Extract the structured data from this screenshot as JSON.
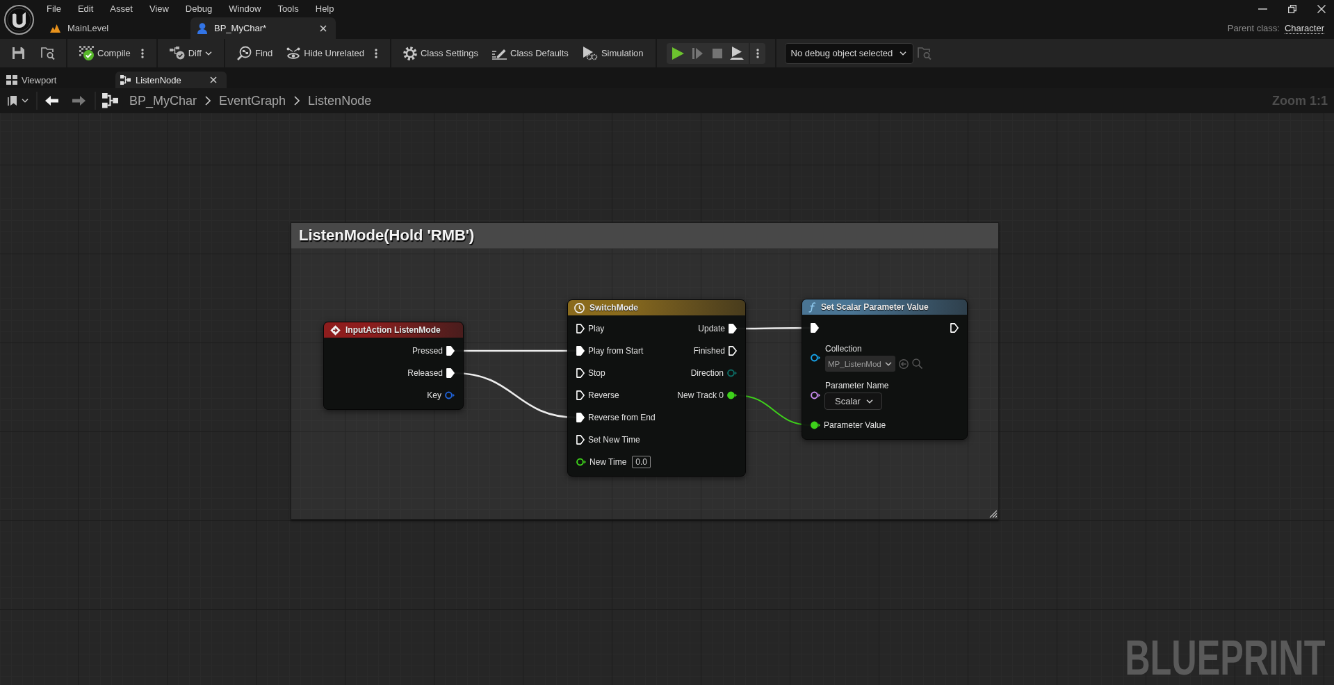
{
  "menu_bar": {
    "items": [
      "File",
      "Edit",
      "Asset",
      "View",
      "Debug",
      "Window",
      "Tools",
      "Help"
    ]
  },
  "document_tabs": [
    {
      "label": "MainLevel",
      "kind": "level",
      "selected": false
    },
    {
      "label": "BP_MyChar*",
      "kind": "blueprint",
      "selected": true
    }
  ],
  "parent_class": {
    "label": "Parent class:",
    "value": "Character"
  },
  "toolbar": {
    "buttons": [
      {
        "kind": "compile",
        "label": "Compile"
      },
      {
        "kind": "diff",
        "label": "Diff"
      },
      {
        "kind": "find",
        "label": "Find"
      },
      {
        "kind": "hide_unrelated",
        "label": "Hide Unrelated"
      },
      {
        "kind": "class_settings",
        "label": "Class Settings"
      },
      {
        "kind": "class_defaults",
        "label": "Class Defaults"
      },
      {
        "kind": "simulation",
        "label": "Simulation"
      }
    ],
    "play_controls": [
      {
        "kind": "play",
        "disabled": false
      },
      {
        "kind": "step",
        "disabled": true
      },
      {
        "kind": "stop",
        "disabled": true
      },
      {
        "kind": "possess",
        "disabled": false
      }
    ],
    "debug_object": "No debug object selected"
  },
  "editor_tabs": [
    {
      "label": "Viewport",
      "kind": "viewport",
      "selected": false
    },
    {
      "label": "ListenNode",
      "kind": "graph",
      "selected": true
    }
  ],
  "breadcrumb": [
    "BP_MyChar",
    "EventGraph",
    "ListenNode"
  ],
  "graph": {
    "zoom": "Zoom 1:1",
    "comment": {
      "title": "ListenMode(Hold 'RMB')"
    },
    "nodes": [
      {
        "kind": "event",
        "title": "InputAction ListenMode",
        "color": "#8e1d1d",
        "outputs": [
          {
            "label": "Pressed",
            "kind": "exec",
            "connected": true
          },
          {
            "label": "Released",
            "kind": "exec",
            "connected": true
          },
          {
            "label": "Key",
            "kind": "struct",
            "connected": false
          }
        ]
      },
      {
        "kind": "timeline",
        "title": "SwitchMode",
        "color": "#8a6b1d",
        "inputs": [
          {
            "label": "Play",
            "kind": "exec",
            "connected": false
          },
          {
            "label": "Play from Start",
            "kind": "exec",
            "connected": true
          },
          {
            "label": "Stop",
            "kind": "exec",
            "connected": false
          },
          {
            "label": "Reverse",
            "kind": "exec",
            "connected": false
          },
          {
            "label": "Reverse from End",
            "kind": "exec",
            "connected": true
          },
          {
            "label": "Set New Time",
            "kind": "exec",
            "connected": false
          },
          {
            "label": "New Time",
            "kind": "float",
            "connected": false,
            "value": "0.0"
          }
        ],
        "outputs": [
          {
            "label": "Update",
            "kind": "exec",
            "connected": true
          },
          {
            "label": "Finished",
            "kind": "exec",
            "connected": false
          },
          {
            "label": "Direction",
            "kind": "enum",
            "connected": false
          },
          {
            "label": "New Track 0",
            "kind": "float",
            "connected": true
          }
        ]
      },
      {
        "kind": "function",
        "title": "Set Scalar Parameter Value",
        "color": "#4a7594",
        "inputs": [
          {
            "kind": "exec",
            "connected": true
          },
          {
            "label": "Collection",
            "kind": "object",
            "connected": false,
            "value": "MP_ListenMod"
          },
          {
            "label": "Parameter Name",
            "kind": "name",
            "connected": false,
            "value": "Scalar"
          },
          {
            "label": "Parameter Value",
            "kind": "float",
            "connected": true
          }
        ],
        "outputs": [
          {
            "kind": "exec",
            "connected": false
          }
        ]
      }
    ],
    "graph_type": "BLUEPRINT"
  }
}
